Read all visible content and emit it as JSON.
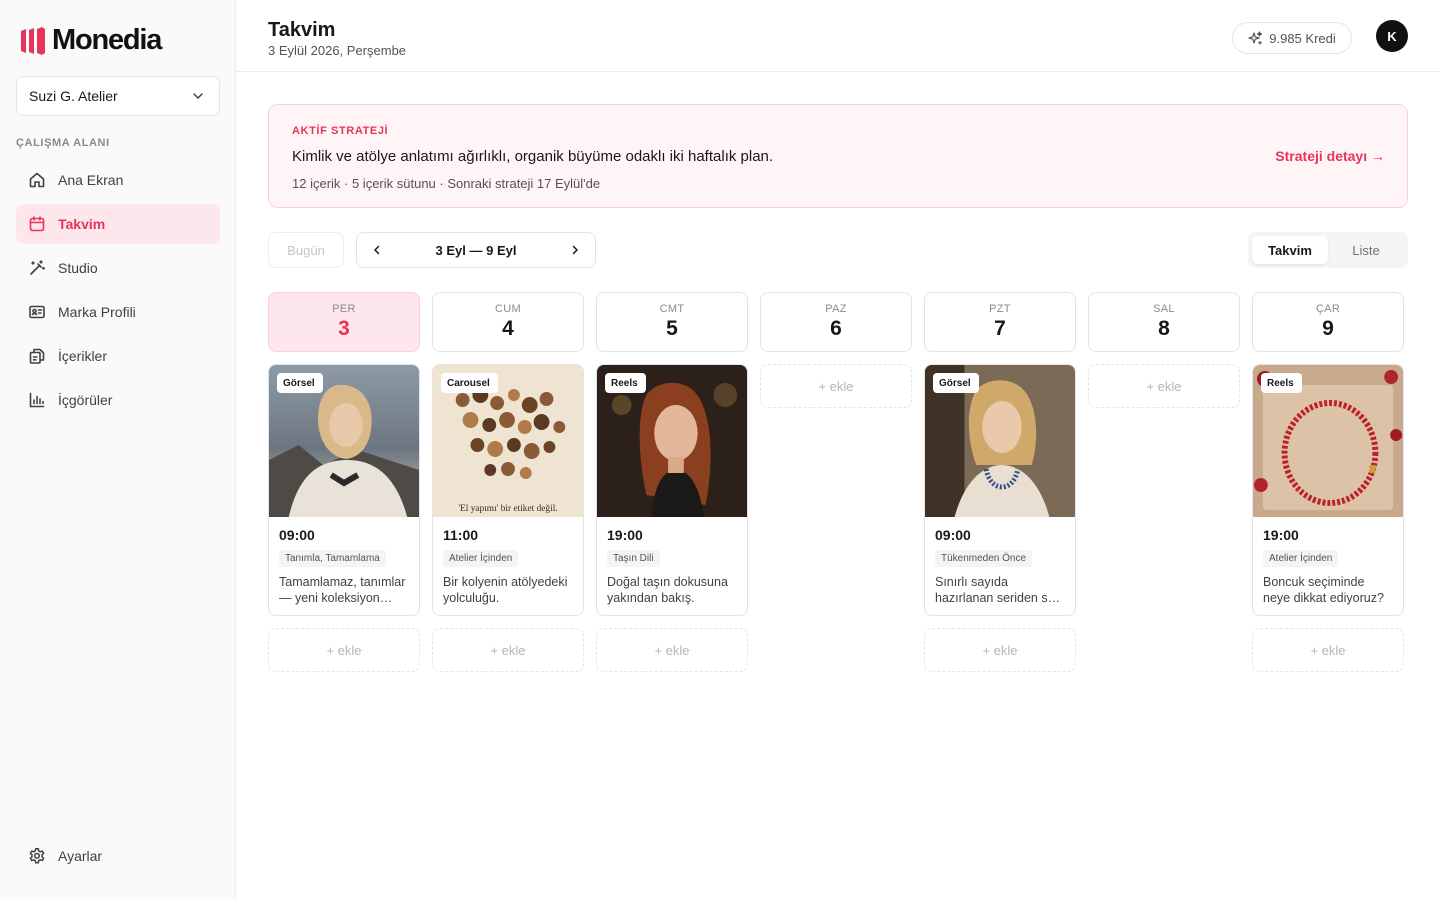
{
  "app": {
    "logo_text": "Monedia"
  },
  "colors": {
    "accent": "#e8345a",
    "accent_bg": "#fde7ec"
  },
  "sidebar": {
    "workspace": "Suzi G. Atelier",
    "section_label": "ÇALIŞMA ALANI",
    "items": [
      {
        "label": "Ana Ekran",
        "icon": "home-icon"
      },
      {
        "label": "Takvim",
        "icon": "calendar-icon",
        "active": true
      },
      {
        "label": "Studio",
        "icon": "magic-wand-icon"
      },
      {
        "label": "Marka Profili",
        "icon": "id-card-icon"
      },
      {
        "label": "İçerikler",
        "icon": "copy-icon"
      },
      {
        "label": "İçgörüler",
        "icon": "bar-chart-icon"
      }
    ],
    "settings_label": "Ayarlar"
  },
  "header": {
    "title": "Takvim",
    "date": "3 Eylül 2026, Perşembe",
    "credits": "9.985 Kredi",
    "avatar_initial": "K"
  },
  "strategy": {
    "kicker": "AKTİF STRATEJİ",
    "text": "Kimlik ve atölye anlatımı ağırlıklı, organik büyüme odaklı iki haftalık plan.",
    "meta": "12 içerik · 5 içerik sütunu · Sonraki strateji 17 Eylül'de",
    "link": "Strateji detayı →"
  },
  "toolbar": {
    "today": "Bugün",
    "range": "3 Eyl — 9 Eyl",
    "views": [
      "Takvim",
      "Liste"
    ]
  },
  "add_label": "+ ekle",
  "days": [
    {
      "dow": "PER",
      "num": "3",
      "today": true,
      "post": {
        "type": "Görsel",
        "time": "09:00",
        "pillar": "Tanımla, Tamamlama",
        "desc": "Tamamlamaz, tanımlar — yeni koleksiyon yayını"
      }
    },
    {
      "dow": "CUM",
      "num": "4",
      "post": {
        "type": "Carousel",
        "time": "11:00",
        "pillar": "Atelier İçinden",
        "desc": "Bir kolyenin atölyedeki yolculuğu.",
        "image_text": "'El yapımı' bir etiket değil."
      }
    },
    {
      "dow": "CMT",
      "num": "5",
      "post": {
        "type": "Reels",
        "time": "19:00",
        "pillar": "Taşın Dili",
        "desc": "Doğal taşın dokusuna yakından bakış."
      }
    },
    {
      "dow": "PAZ",
      "num": "6"
    },
    {
      "dow": "PZT",
      "num": "7",
      "post": {
        "type": "Görsel",
        "time": "09:00",
        "pillar": "Tükenmeden Önce",
        "desc": "Sınırlı sayıda hazırlanan seriden son parçalar."
      }
    },
    {
      "dow": "SAL",
      "num": "8"
    },
    {
      "dow": "ÇAR",
      "num": "9",
      "post": {
        "type": "Reels",
        "time": "19:00",
        "pillar": "Atelier İçinden",
        "desc": "Boncuk seçiminde neye dikkat ediyoruz?"
      }
    }
  ]
}
